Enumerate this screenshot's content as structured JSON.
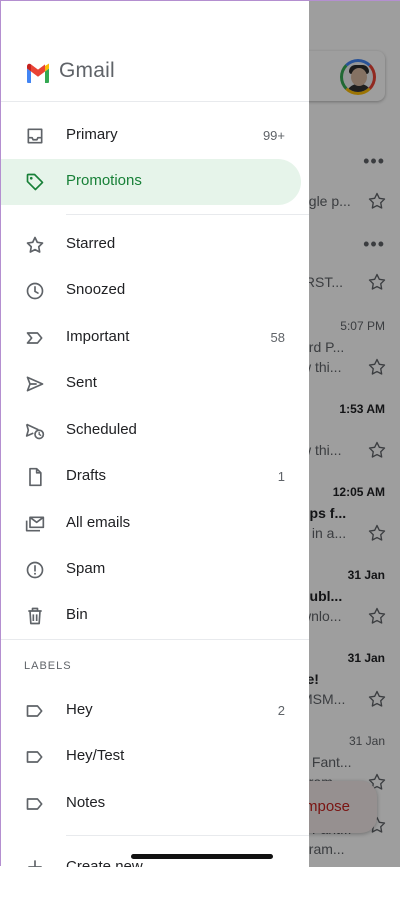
{
  "app": {
    "title": "Gmail"
  },
  "nav": {
    "items": [
      {
        "label": "Primary",
        "count": "99+",
        "icon": "inbox-icon"
      },
      {
        "label": "Promotions",
        "count": "",
        "icon": "tag-icon",
        "active": true
      },
      {
        "label": "Starred",
        "count": "",
        "icon": "star-icon"
      },
      {
        "label": "Snoozed",
        "count": "",
        "icon": "clock-icon"
      },
      {
        "label": "Important",
        "count": "58",
        "icon": "important-icon"
      },
      {
        "label": "Sent",
        "count": "",
        "icon": "send-icon"
      },
      {
        "label": "Scheduled",
        "count": "",
        "icon": "scheduled-icon"
      },
      {
        "label": "Drafts",
        "count": "1",
        "icon": "draft-icon"
      },
      {
        "label": "All emails",
        "count": "",
        "icon": "all-mail-icon"
      },
      {
        "label": "Spam",
        "count": "",
        "icon": "spam-icon"
      },
      {
        "label": "Bin",
        "count": "",
        "icon": "trash-icon"
      }
    ],
    "labels_heading": "LABELS",
    "labels": [
      {
        "label": "Hey",
        "count": "2"
      },
      {
        "label": "Hey/Test",
        "count": ""
      },
      {
        "label": "Notes",
        "count": ""
      }
    ],
    "create_new": "Create new"
  },
  "inbox_background": {
    "rows": [
      {
        "time": "",
        "line1": "",
        "line2": "ogle p..."
      },
      {
        "time": "",
        "line1": "",
        "line2": "IRST..."
      },
      {
        "time": "5:07 PM",
        "line1": "ard P...",
        "line2": "w thi..."
      },
      {
        "time": "1:53 AM",
        "line1": "",
        "line2": "w thi..."
      },
      {
        "time": "12:05 AM",
        "line1": "ups f...",
        "line2": "s in a..."
      },
      {
        "time": "31 Jan",
        "line1": "publ...",
        "line2": "wnlo..."
      },
      {
        "time": "31 Jan",
        "line1": "re!",
        "line2": "MSM..."
      },
      {
        "time": "31 Jan",
        "line1": "y Fant...",
        "line2": "gram..."
      },
      {
        "time": "",
        "line1": "y Fant...",
        "line2": "gram..."
      }
    ],
    "compose_label": "mpose"
  },
  "colors": {
    "accent_green": "#188038",
    "active_bg": "#e6f4ea",
    "compose_red": "#c5221f"
  }
}
